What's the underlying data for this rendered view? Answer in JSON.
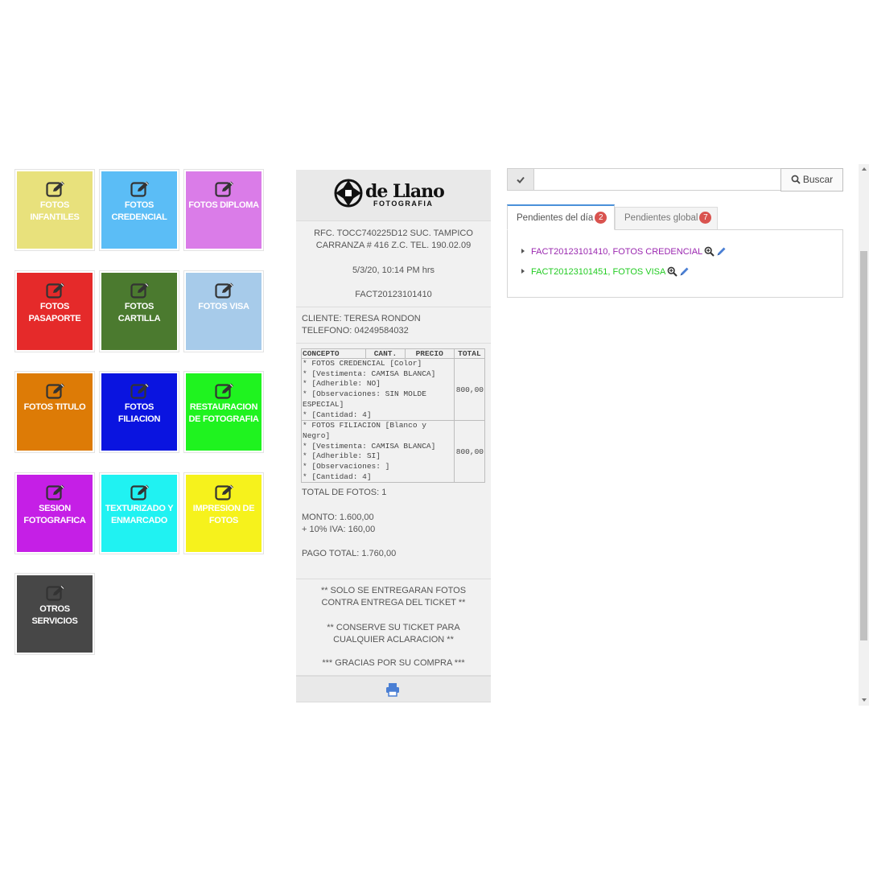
{
  "services": [
    {
      "label": "FOTOS INFANTILES",
      "color": "#e8e17c",
      "text_color": "#ffffff"
    },
    {
      "label": "FOTOS CREDENCIAL",
      "color": "#5bbdf6",
      "text_color": "#ffffff"
    },
    {
      "label": "FOTOS DIPLOMA",
      "color": "#da7ce8",
      "text_color": "#ffffff"
    },
    {
      "label": "FOTOS PASAPORTE",
      "color": "#e52a2a",
      "text_color": "#ffffff"
    },
    {
      "label": "FOTOS CARTILLA",
      "color": "#4b7a2f",
      "text_color": "#ffffff"
    },
    {
      "label": "FOTOS VISA",
      "color": "#a7cbea",
      "text_color": "#ffffff"
    },
    {
      "label": "FOTOS TITULO",
      "color": "#dd7b06",
      "text_color": "#ffffff"
    },
    {
      "label": "FOTOS FILIACION",
      "color": "#0a14e0",
      "text_color": "#ffffff"
    },
    {
      "label": "RESTAURACION DE FOTOGRAFIA",
      "color": "#1ff31f",
      "text_color": "#ffffff"
    },
    {
      "label": "SESION FOTOGRAFICA",
      "color": "#c51fe6",
      "text_color": "#ffffff"
    },
    {
      "label": "TEXTURIZADO Y ENMARCADO",
      "color": "#20f2f2",
      "text_color": "#ffffff"
    },
    {
      "label": "IMPRESION DE FOTOS",
      "color": "#f6f21c",
      "text_color": "#ffffff"
    },
    {
      "label": "OTROS SERVICIOS",
      "color": "#474747",
      "text_color": "#ffffff"
    }
  ],
  "tile_icon": "edit-icon",
  "ticket": {
    "brand": "de Llano",
    "brand_sub": "FOTOGRAFIA",
    "rfc_line": "RFC. TOCC740225D12 SUC. TAMPICO",
    "address_line": "CARRANZA # 416 Z.C. TEL. 190.02.09",
    "datetime": "5/3/20, 10:14 PM hrs",
    "folio": "FACT20123101410",
    "client": "CLIENTE: TERESA RONDON",
    "phone": "TELEFONO: 04249584032",
    "table_headers": {
      "concepto": "CONCEPTO",
      "cant": "CANT.",
      "precio": "PRECIO",
      "total": "TOTAL"
    },
    "items": [
      {
        "lines": [
          "* FOTOS CREDENCIAL [Color]",
          "* [Vestimenta: CAMISA BLANCA]",
          "* [Adherible: NO]",
          "* [Observaciones: SIN MOLDE ESPECIAL]",
          "* [Cantidad: 4]"
        ],
        "total": "800,00"
      },
      {
        "lines": [
          "* FOTOS FILIACION [Blanco y Negro]",
          "* [Vestimenta: CAMISA BLANCA]",
          "* [Adherible: SI]",
          "* [Observaciones: ]",
          "* [Cantidad: 4]"
        ],
        "total": "800,00"
      }
    ],
    "total_fotos": "TOTAL DE FOTOS: 1",
    "monto": "MONTO: 1.600,00",
    "iva": "+ 10% IVA: 160,00",
    "pago_total": "PAGO TOTAL: 1.760,00",
    "note1": "** SOLO SE ENTREGARAN FOTOS CONTRA ENTREGA DEL TICKET **",
    "note2": "** CONSERVE SU TICKET PARA CUALQUIER ACLARACION **",
    "note3": "*** GRACIAS POR SU COMPRA ***",
    "print_icon": "print-icon",
    "accent": "#4a7fd4"
  },
  "search": {
    "value": "",
    "placeholder": "",
    "button_label": "Buscar",
    "check_icon": "check-icon"
  },
  "tabs": [
    {
      "label": "Pendientes del día",
      "badge": "2",
      "active": true
    },
    {
      "label": "Pendientes global",
      "badge": "7",
      "active": false
    }
  ],
  "pending": [
    {
      "text": "FACT20123101410, FOTOS CREDENCIAL",
      "color": "#9b27b0"
    },
    {
      "text": "FACT20123101451, FOTOS VISA",
      "color": "#22cc22"
    }
  ]
}
